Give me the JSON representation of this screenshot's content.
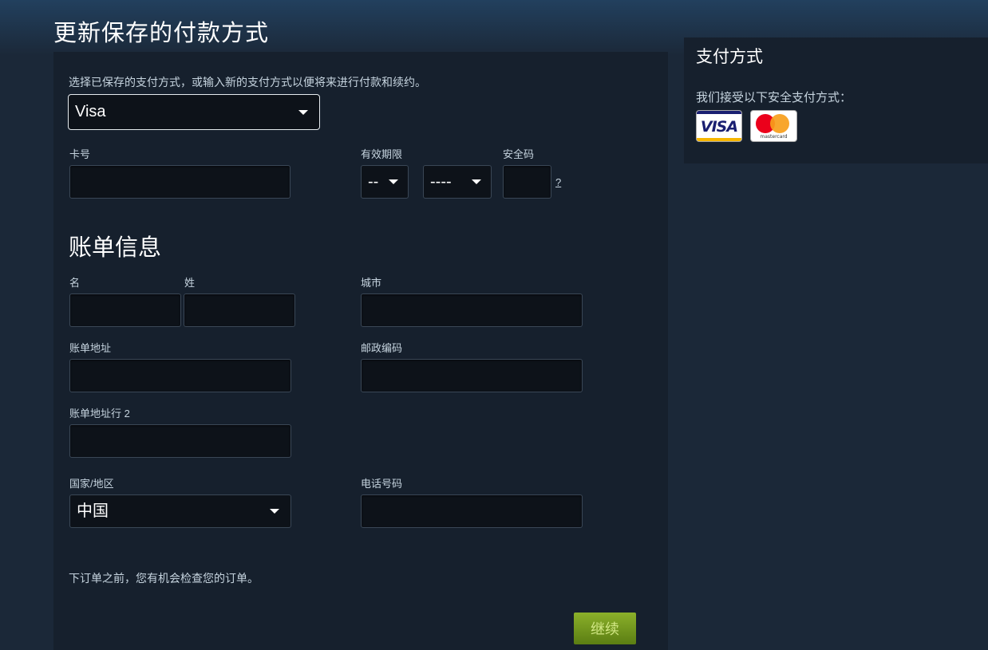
{
  "page": {
    "title": "更新保存的付款方式"
  },
  "payment": {
    "intro": "选择已保存的支付方式，或输入新的支付方式以便将来进行付款和续约。",
    "saved_method": "Visa",
    "card_number_label": "卡号",
    "expiration_label": "有效期限",
    "expiration_month": "--",
    "expiration_year": "----",
    "cvv_label": "安全码",
    "cvv_help": "?"
  },
  "billing": {
    "title": "账单信息",
    "first_name_label": "名",
    "last_name_label": "姓",
    "city_label": "城市",
    "address_label": "账单地址",
    "postal_label": "邮政编码",
    "address2_label": "账单地址行 2",
    "country_label": "国家/地区",
    "country_value": "中国",
    "phone_label": "电话号码"
  },
  "footer": {
    "note": "下订单之前，您有机会检查您的订单。",
    "continue_label": "继续"
  },
  "sidebar": {
    "title": "支付方式",
    "accepted_text": "我们接受以下安全支付方式：",
    "cards": [
      {
        "name": "visa-card-logo",
        "text": "VISA",
        "colors": {
          "primary": "#1a1f71",
          "accent": "#f7b600"
        }
      },
      {
        "name": "mastercard-logo",
        "text": "mastercard",
        "colors": {
          "left": "#eb001b",
          "right": "#f79e1b"
        }
      }
    ]
  },
  "colors": {
    "background": "#1b2838",
    "panel": "#16202d",
    "field": "#0d1219",
    "button": "#6f9a1e",
    "button_text": "#d2e885"
  }
}
